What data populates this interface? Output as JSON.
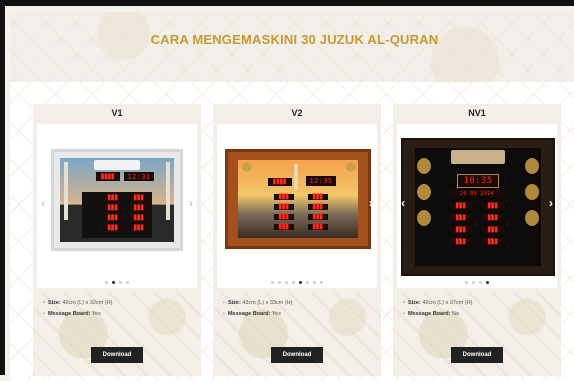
{
  "header": {
    "title": "CARA MENGEMASKINI 30 JUZUK AL-QURAN"
  },
  "colors": {
    "accent": "#c79a2e",
    "button": "#222222",
    "led": "#ff2a1a"
  },
  "icons": {
    "prev": "chevron-left-icon",
    "next": "chevron-right-icon"
  },
  "cards": [
    {
      "title": "V1",
      "size_label": "Size:",
      "size_value": "42cm (L) x 32cm (H)",
      "board_label": "Message Board:",
      "board_value": "Yes",
      "download": "Download",
      "display": {
        "time": "12:31",
        "date": "",
        "active_dot": 2,
        "dot_count": 4
      }
    },
    {
      "title": "V2",
      "size_label": "Size:",
      "size_value": "43cm (L) x 33cm (H)",
      "board_label": "Message Board:",
      "board_value": "Yes",
      "download": "Download",
      "display": {
        "time": "12:35",
        "date": "",
        "active_dot": 5,
        "dot_count": 8
      }
    },
    {
      "title": "NV1",
      "size_label": "Size:",
      "size_value": "42cm (L) x 37cm (H)",
      "board_label": "Message Board:",
      "board_value": "No",
      "download": "Download",
      "display": {
        "time": "10:35",
        "date": "26 09 2024",
        "active_dot": 4,
        "dot_count": 4
      }
    }
  ]
}
